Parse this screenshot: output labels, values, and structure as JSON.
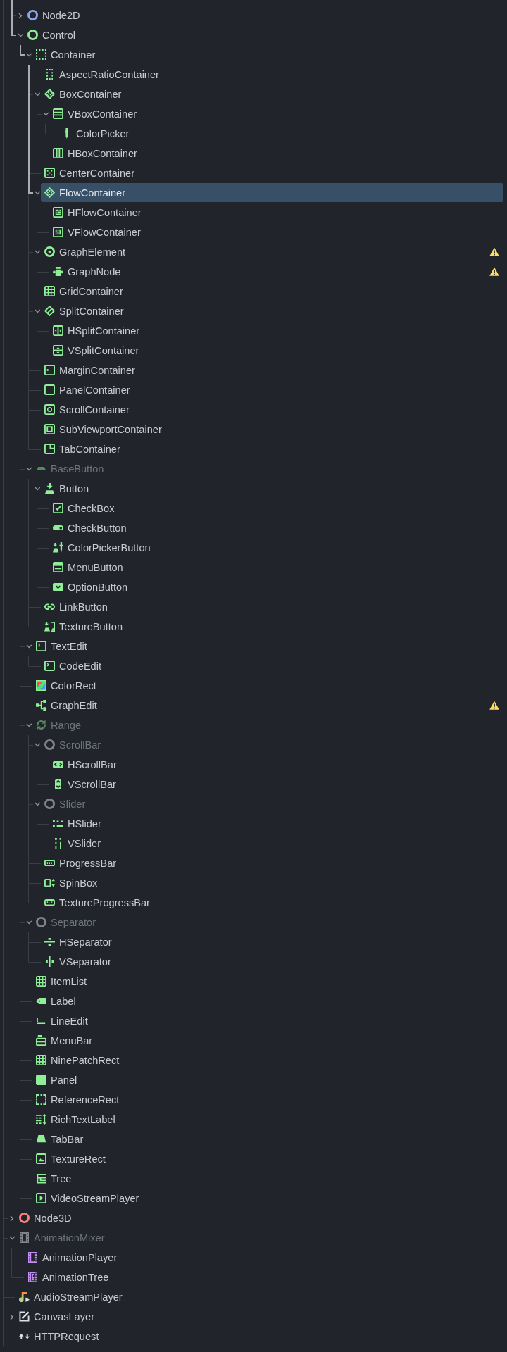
{
  "tree": {
    "items": [
      {
        "children": [
          {
            "label": "Node2D",
            "expanded": false,
            "selected": false,
            "disabled": false,
            "warning": false
          },
          {
            "label": "Control",
            "expanded": true,
            "selected": false,
            "disabled": false,
            "warning": false,
            "children": [
              {
                "label": "Container",
                "expanded": true,
                "selected": false,
                "disabled": false,
                "warning": false,
                "children": [
                  {
                    "label": "AspectRatioContainer",
                    "selected": false,
                    "disabled": false,
                    "warning": false
                  },
                  {
                    "label": "BoxContainer",
                    "expanded": true,
                    "selected": false,
                    "disabled": false,
                    "warning": false,
                    "children": [
                      {
                        "label": "VBoxContainer",
                        "expanded": true,
                        "selected": false,
                        "disabled": false,
                        "warning": false,
                        "children": [
                          {
                            "label": "ColorPicker",
                            "selected": false,
                            "disabled": false,
                            "warning": false
                          }
                        ]
                      },
                      {
                        "label": "HBoxContainer",
                        "selected": false,
                        "disabled": false,
                        "warning": false
                      }
                    ]
                  },
                  {
                    "label": "CenterContainer",
                    "selected": false,
                    "disabled": false,
                    "warning": false
                  },
                  {
                    "label": "FlowContainer",
                    "expanded": true,
                    "selected": true,
                    "disabled": false,
                    "warning": false,
                    "children": [
                      {
                        "label": "HFlowContainer",
                        "selected": false,
                        "disabled": false,
                        "warning": false
                      },
                      {
                        "label": "VFlowContainer",
                        "selected": false,
                        "disabled": false,
                        "warning": false
                      }
                    ]
                  },
                  {
                    "label": "GraphElement",
                    "expanded": true,
                    "selected": false,
                    "disabled": false,
                    "warning": true,
                    "children": [
                      {
                        "label": "GraphNode",
                        "selected": false,
                        "disabled": false,
                        "warning": true
                      }
                    ]
                  },
                  {
                    "label": "GridContainer",
                    "selected": false,
                    "disabled": false,
                    "warning": false
                  },
                  {
                    "label": "SplitContainer",
                    "expanded": true,
                    "selected": false,
                    "disabled": false,
                    "warning": false,
                    "children": [
                      {
                        "label": "HSplitContainer",
                        "selected": false,
                        "disabled": false,
                        "warning": false
                      },
                      {
                        "label": "VSplitContainer",
                        "selected": false,
                        "disabled": false,
                        "warning": false
                      }
                    ]
                  },
                  {
                    "label": "MarginContainer",
                    "selected": false,
                    "disabled": false,
                    "warning": false
                  },
                  {
                    "label": "PanelContainer",
                    "selected": false,
                    "disabled": false,
                    "warning": false
                  },
                  {
                    "label": "ScrollContainer",
                    "selected": false,
                    "disabled": false,
                    "warning": false
                  },
                  {
                    "label": "SubViewportContainer",
                    "selected": false,
                    "disabled": false,
                    "warning": false
                  },
                  {
                    "label": "TabContainer",
                    "selected": false,
                    "disabled": false,
                    "warning": false
                  }
                ]
              },
              {
                "label": "BaseButton",
                "expanded": true,
                "selected": false,
                "disabled": true,
                "warning": false,
                "children": [
                  {
                    "label": "Button",
                    "expanded": true,
                    "selected": false,
                    "disabled": false,
                    "warning": false,
                    "children": [
                      {
                        "label": "CheckBox",
                        "selected": false,
                        "disabled": false,
                        "warning": false
                      },
                      {
                        "label": "CheckButton",
                        "selected": false,
                        "disabled": false,
                        "warning": false
                      },
                      {
                        "label": "ColorPickerButton",
                        "selected": false,
                        "disabled": false,
                        "warning": false
                      },
                      {
                        "label": "MenuButton",
                        "selected": false,
                        "disabled": false,
                        "warning": false
                      },
                      {
                        "label": "OptionButton",
                        "selected": false,
                        "disabled": false,
                        "warning": false
                      }
                    ]
                  },
                  {
                    "label": "LinkButton",
                    "selected": false,
                    "disabled": false,
                    "warning": false
                  },
                  {
                    "label": "TextureButton",
                    "selected": false,
                    "disabled": false,
                    "warning": false
                  }
                ]
              },
              {
                "label": "TextEdit",
                "expanded": true,
                "selected": false,
                "disabled": false,
                "warning": false,
                "children": [
                  {
                    "label": "CodeEdit",
                    "selected": false,
                    "disabled": false,
                    "warning": false
                  }
                ]
              },
              {
                "label": "ColorRect",
                "selected": false,
                "disabled": false,
                "warning": false
              },
              {
                "label": "GraphEdit",
                "selected": false,
                "disabled": false,
                "warning": true
              },
              {
                "label": "Range",
                "expanded": true,
                "selected": false,
                "disabled": true,
                "warning": false,
                "children": [
                  {
                    "label": "ScrollBar",
                    "expanded": true,
                    "selected": false,
                    "disabled": true,
                    "warning": false,
                    "children": [
                      {
                        "label": "HScrollBar",
                        "selected": false,
                        "disabled": false,
                        "warning": false
                      },
                      {
                        "label": "VScrollBar",
                        "selected": false,
                        "disabled": false,
                        "warning": false
                      }
                    ]
                  },
                  {
                    "label": "Slider",
                    "expanded": true,
                    "selected": false,
                    "disabled": true,
                    "warning": false,
                    "children": [
                      {
                        "label": "HSlider",
                        "selected": false,
                        "disabled": false,
                        "warning": false
                      },
                      {
                        "label": "VSlider",
                        "selected": false,
                        "disabled": false,
                        "warning": false
                      }
                    ]
                  },
                  {
                    "label": "ProgressBar",
                    "selected": false,
                    "disabled": false,
                    "warning": false
                  },
                  {
                    "label": "SpinBox",
                    "selected": false,
                    "disabled": false,
                    "warning": false
                  },
                  {
                    "label": "TextureProgressBar",
                    "selected": false,
                    "disabled": false,
                    "warning": false
                  }
                ]
              },
              {
                "label": "Separator",
                "expanded": true,
                "selected": false,
                "disabled": true,
                "warning": false,
                "children": [
                  {
                    "label": "HSeparator",
                    "selected": false,
                    "disabled": false,
                    "warning": false
                  },
                  {
                    "label": "VSeparator",
                    "selected": false,
                    "disabled": false,
                    "warning": false
                  }
                ]
              },
              {
                "label": "ItemList",
                "selected": false,
                "disabled": false,
                "warning": false
              },
              {
                "label": "Label",
                "selected": false,
                "disabled": false,
                "warning": false
              },
              {
                "label": "LineEdit",
                "selected": false,
                "disabled": false,
                "warning": false
              },
              {
                "label": "MenuBar",
                "selected": false,
                "disabled": false,
                "warning": false
              },
              {
                "label": "NinePatchRect",
                "selected": false,
                "disabled": false,
                "warning": false
              },
              {
                "label": "Panel",
                "selected": false,
                "disabled": false,
                "warning": false
              },
              {
                "label": "ReferenceRect",
                "selected": false,
                "disabled": false,
                "warning": false
              },
              {
                "label": "RichTextLabel",
                "selected": false,
                "disabled": false,
                "warning": false
              },
              {
                "label": "TabBar",
                "selected": false,
                "disabled": false,
                "warning": false
              },
              {
                "label": "TextureRect",
                "selected": false,
                "disabled": false,
                "warning": false
              },
              {
                "label": "Tree",
                "selected": false,
                "disabled": false,
                "warning": false
              },
              {
                "label": "VideoStreamPlayer",
                "selected": false,
                "disabled": false,
                "warning": false
              }
            ]
          }
        ]
      },
      {
        "label": "Node3D",
        "expanded": false,
        "selected": false,
        "disabled": false,
        "warning": false
      },
      {
        "label": "AnimationMixer",
        "expanded": true,
        "selected": false,
        "disabled": true,
        "warning": false,
        "children": [
          {
            "label": "AnimationPlayer",
            "selected": false,
            "disabled": false,
            "warning": false
          },
          {
            "label": "AnimationTree",
            "selected": false,
            "disabled": false,
            "warning": false
          }
        ]
      },
      {
        "label": "AudioStreamPlayer",
        "selected": false,
        "disabled": false,
        "warning": false
      },
      {
        "label": "CanvasLayer",
        "expanded": false,
        "selected": false,
        "disabled": false,
        "warning": false
      },
      {
        "label": "HTTPRequest",
        "selected": false,
        "disabled": false,
        "warning": false
      }
    ]
  }
}
